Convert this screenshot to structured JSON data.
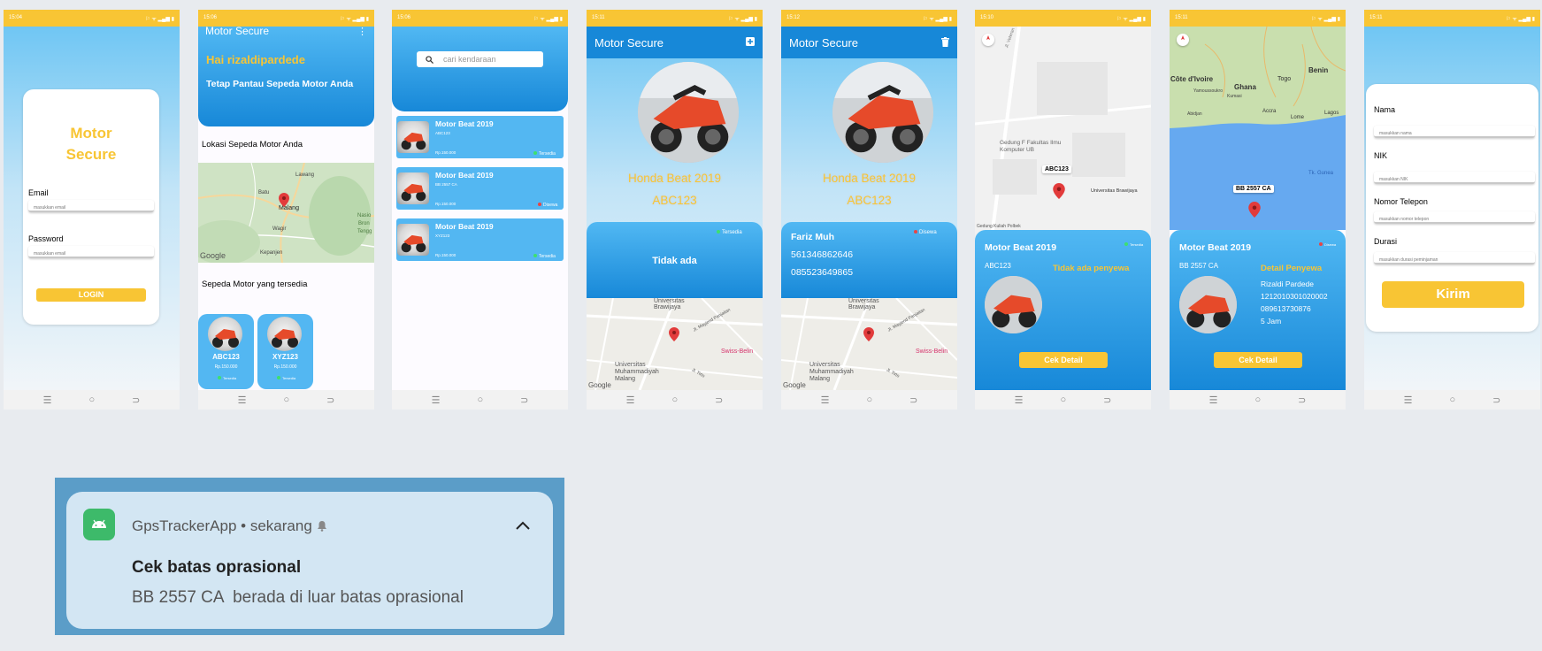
{
  "status": {
    "p1_time": "15:04",
    "p2_time": "15:06",
    "p3_time": "15:06",
    "p4_time": "15:11",
    "p5_time": "15:12",
    "p6_time": "15:10",
    "p7_time": "15:11",
    "p8_time": "15:11",
    "p1_icons": "☉ ⚙",
    "p2_icons": "▰ ⚙",
    "p3_icons": "▰ ⚙",
    "p4_icons": "▰ ⚙",
    "p5_icons": "▰ ⚙",
    "p6_icons": "▰ ⚙",
    "p7_icons": "▰ ⚙",
    "p8_icons": "▰ ⚙",
    "right_icons": "⚐ ᯤ ▂▄▆ ▮"
  },
  "nav": {
    "menu": "☰",
    "home": "○",
    "back": "⊃"
  },
  "login": {
    "title_line1": "Motor",
    "title_line2": "Secure",
    "email_label": "Email",
    "email_placeholder": "masukkan email",
    "password_label": "Password",
    "password_placeholder": "masukkan email",
    "login_button": "LOGIN"
  },
  "home": {
    "appbar_title": "Motor Secure",
    "menu_dots": "⋮",
    "greeting": "Hai rizaldipardede",
    "subtitle": "Tetap Pantau Sepeda Motor Anda",
    "location_title": "Lokasi Sepeda Motor Anda",
    "map_labels": [
      "Lawang",
      "Batu",
      "Malang",
      "Wagir",
      "Kepanjen",
      "Nasio",
      "Bron",
      "Tengg"
    ],
    "google": "Google",
    "available_title": "Sepeda Motor yang tersedia",
    "cards": [
      {
        "plate": "ABC123",
        "price": "Rp.150.000",
        "status": "Tersedia"
      },
      {
        "plate": "XYZ123",
        "price": "Rp.150.000",
        "status": "Tersedia"
      }
    ]
  },
  "search": {
    "placeholder": "cari kendaraan",
    "items": [
      {
        "name": "Motor Beat 2019",
        "plate": "ABC123",
        "price": "Rp.150.000",
        "status": "Tersedia"
      },
      {
        "name": "Motor Beat 2019",
        "plate": "BB 2557 CA",
        "price": "Rp.150.000",
        "status": "Disewa"
      },
      {
        "name": "Motor Beat 2019",
        "plate": "XYZ123",
        "price": "Rp.150.000",
        "status": "Tersedia"
      }
    ]
  },
  "detail_available": {
    "appbar_title": "Motor Secure",
    "action_icon": "plus",
    "name": "Honda Beat 2019",
    "plate": "ABC123",
    "status": "Tersedia",
    "renter": "Tidak ada",
    "map_labels": [
      "Universitas Brawijaya",
      "Jl. Mayjend Panjaitan",
      "Swiss-Belin",
      "Universitas Muhammadiyah Malang",
      "Jl. Tirto"
    ],
    "google": "Google"
  },
  "detail_rented": {
    "appbar_title": "Motor Secure",
    "action_icon": "trash",
    "name": "Honda Beat 2019",
    "plate": "ABC123",
    "status": "Disewa",
    "renter_name": "Fariz Muh",
    "renter_nik": "561346862646",
    "renter_phone": "085523649865",
    "map_labels": [
      "Universitas Brawijaya",
      "Jl. Mayjend Panjaitan",
      "Swiss-Belin",
      "Universitas Muhammadiyah Malang",
      "Jl. Tirto"
    ],
    "google": "Google"
  },
  "track1": {
    "map_labels": [
      "Jl. Veteran",
      "Gedung F Fakultas Ilmu Komputer UB",
      "Universitas Brawijaya",
      "Gedung Kuliah Polbek"
    ],
    "pin_label": "ABC123",
    "card_title": "Motor Beat 2019",
    "card_status": "Tersedia",
    "plate": "ABC123",
    "renter_note": "Tidak ada penyewa",
    "button": "Cek Detail"
  },
  "track2": {
    "map_labels": [
      "Côte d'Ivoire",
      "Ghana",
      "Togo",
      "Benin",
      "Yamoussoukro",
      "Kumasi",
      "Abidjan",
      "Accra",
      "Lome",
      "Lagos",
      "Tk. Gunea"
    ],
    "pin_label": "BB 2557 CA",
    "card_title": "Motor Beat 2019",
    "card_status": "Disewa",
    "plate": "BB 2557 CA",
    "renter_title": "Detail Penyewa",
    "renter_name": "Rizaldi Pardede",
    "renter_nik": "1212010301020002",
    "renter_phone": "089613730876",
    "renter_duration": "5 Jam",
    "button": "Cek Detail"
  },
  "form": {
    "nama_label": "Nama",
    "nama_placeholder": "masukkan nama",
    "nik_label": "NIK",
    "nik_placeholder": "masukkan NIK",
    "phone_label": "Nomor Telepon",
    "phone_placeholder": "masukkan nomor telepon",
    "durasi_label": "Durasi",
    "durasi_placeholder": "masukkan durasi peminjaman",
    "submit": "Kirim"
  },
  "notification": {
    "app_name": "GpsTrackerApp",
    "separator": "•",
    "time": "sekarang",
    "title": "Cek batas oprasional",
    "body": "BB 2557 CA  berada di luar batas oprasional"
  }
}
